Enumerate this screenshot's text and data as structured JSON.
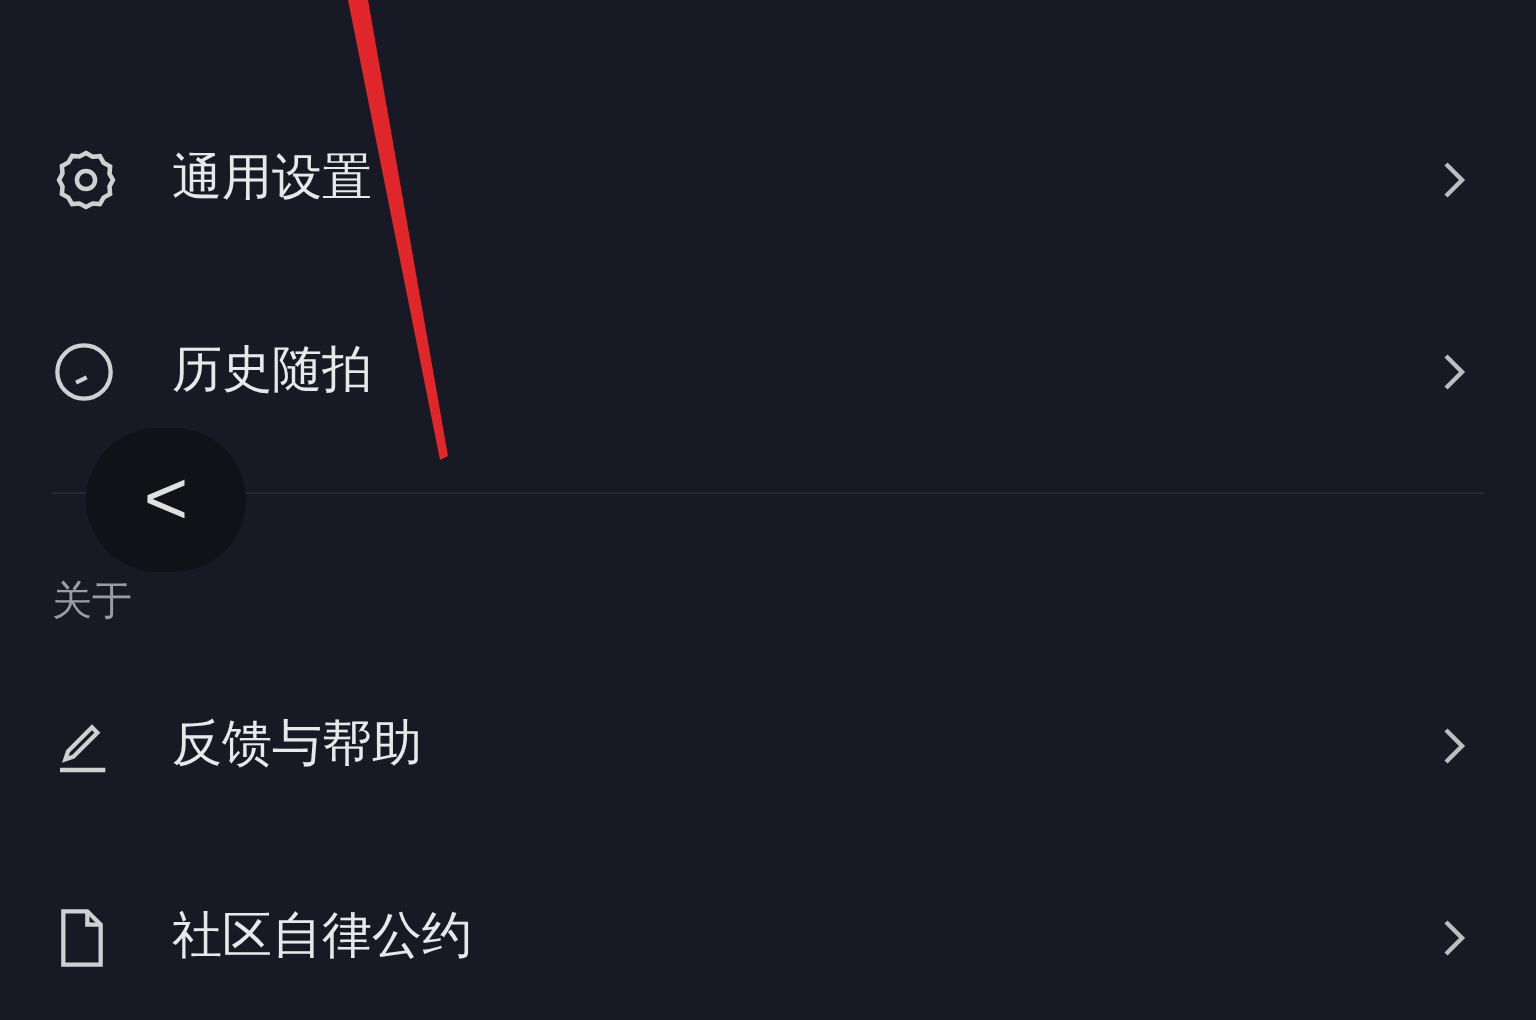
{
  "sections": [
    {
      "items": [
        {
          "label": "通用设置",
          "kind": "gear"
        },
        {
          "label": "历史随拍",
          "kind": "clock"
        }
      ]
    },
    {
      "header": "关于",
      "items": [
        {
          "label": "反馈与帮助",
          "kind": "pencil"
        },
        {
          "label": "社区自律公约",
          "kind": "document"
        }
      ]
    }
  ],
  "back_button": {
    "label": "<"
  }
}
